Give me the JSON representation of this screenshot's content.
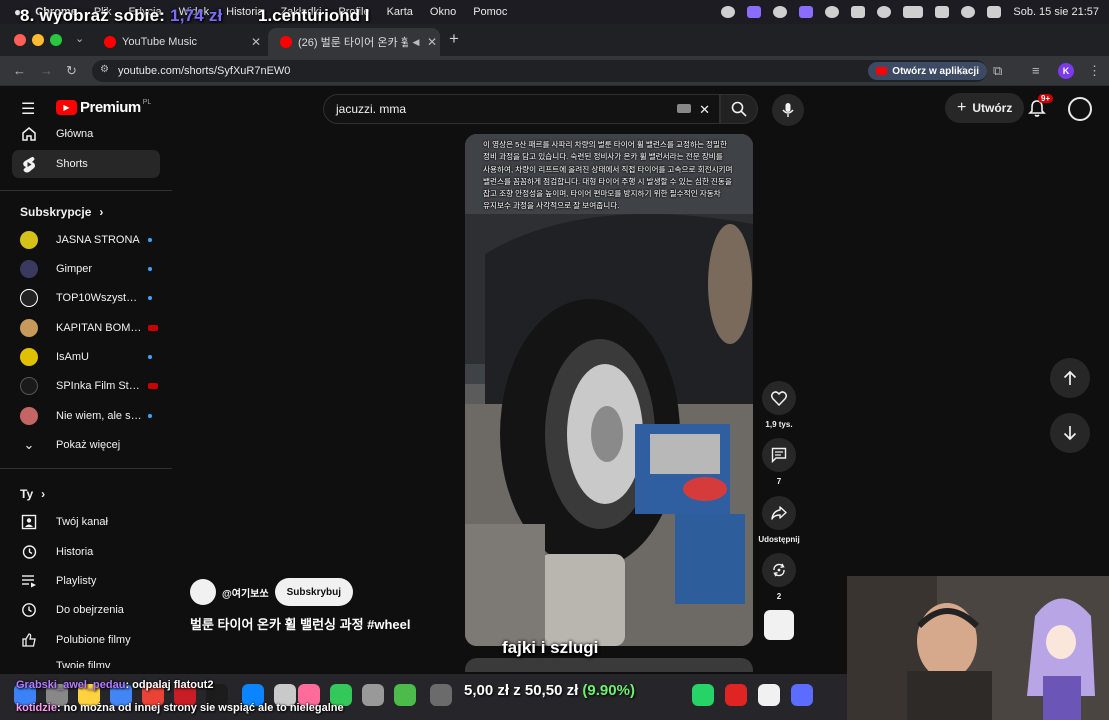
{
  "menubar": {
    "items": [
      "Chrome",
      "Plik",
      "Edycja",
      "Widok",
      "Historia",
      "Zakładki",
      "Profile",
      "Karta",
      "Okno",
      "Pomoc"
    ],
    "datetime": "Sob. 15 sie  21:57"
  },
  "stream_overlay": {
    "top_left": "8. wyobraź sobie:",
    "top_left_price": "1,74 zł",
    "top_right": "1.centuriond l",
    "bottom_center": "fajki i szlugi",
    "donation_amount": "5,00 zł",
    "donation_progress_text": "z 50,50 zł",
    "donation_percent": "(9.90%)",
    "chat": [
      {
        "user": "Grabski_awel_pedau",
        "message": ": odpalaj flatout2"
      },
      {
        "user": "kotidzie",
        "message": ": no można od innej strony sie wspiąć ale to nielegalne"
      }
    ]
  },
  "browser": {
    "tabs": [
      {
        "title": "YouTube Music",
        "active": false
      },
      {
        "title": "(26) 벌룬 타이어 온카 휠 밸런",
        "active": true
      }
    ],
    "url": "youtube.com/shorts/SyfXuR7nEW0",
    "open_in_app": "Otwórz w aplikacji",
    "profile_initial": "K"
  },
  "youtube": {
    "logo_text": "Premium",
    "logo_region": "PL",
    "search_value": "jacuzzi. mma",
    "create_label": "Utwórz",
    "notif_badge": "9+",
    "sidebar": {
      "main": [
        {
          "label": "Główna",
          "icon": "home-icon"
        },
        {
          "label": "Shorts",
          "icon": "shorts-icon",
          "active": true
        }
      ],
      "subs_header": "Subskrypcje",
      "subs": [
        {
          "label": "JASNA STRONA",
          "color": "#d4c21a",
          "badge": "dot"
        },
        {
          "label": "Gimper",
          "color": "#3a3a60",
          "badge": "dot"
        },
        {
          "label": "TOP10Wszystkie...",
          "color": "#ffffff",
          "badge": "dot"
        },
        {
          "label": "KAPITAN BOMB...",
          "color": "#c59a5a",
          "badge": "live"
        },
        {
          "label": "IsAmU",
          "color": "#e0c100",
          "badge": "dot"
        },
        {
          "label": "SPInka Film Stud...",
          "color": "#1a1a1a",
          "badge": "live"
        },
        {
          "label": "Nie wiem, ale się...",
          "color": "#c46565",
          "badge": "dot"
        }
      ],
      "show_more": "Pokaż więcej",
      "you_header": "Ty",
      "you": [
        {
          "label": "Twój kanał",
          "icon": "channel-icon"
        },
        {
          "label": "Historia",
          "icon": "history-icon"
        },
        {
          "label": "Playlisty",
          "icon": "playlist-icon"
        },
        {
          "label": "Do obejrzenia",
          "icon": "clock-icon"
        },
        {
          "label": "Polubione filmy",
          "icon": "thumb-up-icon"
        },
        {
          "label": "Twoje filmy",
          "icon": "video-icon"
        }
      ]
    },
    "short": {
      "caption": "이 영상은 5산 패르를 사파리 차량의 벌룬 타이어 휠 밸런스를 교정하는 정밀한 정비 과정을 담고 있습니다. 숙련된 정비사가 온카 휠 밸런서라는 전문 장비를 사용하여, 차량이 리프트에 올려진 상태에서 직접 타이어를 고속으로 회전시키며 밸런스를 꼼꼼하게 점검합니다. 대형 타이어 주행 시 발생할 수 있는 심한 진동을 잡고 조향 안정성을 높이며, 타이어 편마모를 방지하기 위한 필수적인 자동차 유지보수 과정을 사각적으로 잘 보여줍니다.",
      "channel": "@여기보쏘",
      "subscribe": "Subskrybuj",
      "title": "벌룬 타이어 온카 휠 밸런싱 과정 #wheel",
      "likes": "1,9 tys.",
      "comments": "7",
      "share": "Udostępnij",
      "remix": "2"
    }
  }
}
